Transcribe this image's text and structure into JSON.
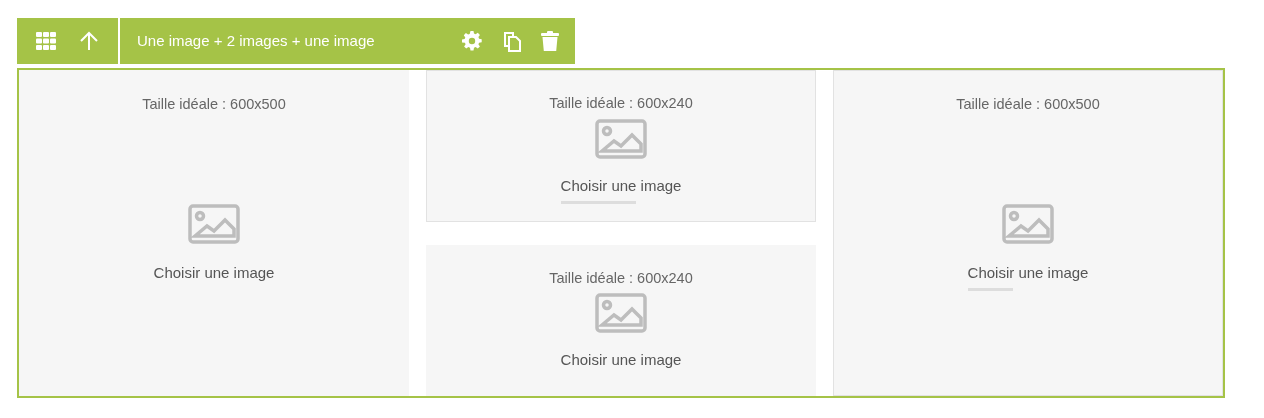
{
  "toolbar": {
    "title": "Une image + 2 images + une image"
  },
  "columns": [
    {
      "slots": [
        {
          "size_hint": "Taille idéale : 600x500",
          "action": "Choisir une image",
          "bordered": false
        }
      ]
    },
    {
      "slots": [
        {
          "size_hint": "Taille idéale : 600x240",
          "action": "Choisir une image",
          "bordered": true,
          "level": 0.62
        },
        {
          "size_hint": "Taille idéale : 600x240",
          "action": "Choisir une image",
          "bordered": false
        }
      ]
    },
    {
      "slots": [
        {
          "size_hint": "Taille idéale : 600x500",
          "action": "Choisir une image",
          "bordered": true,
          "level": 0.38
        }
      ]
    }
  ]
}
